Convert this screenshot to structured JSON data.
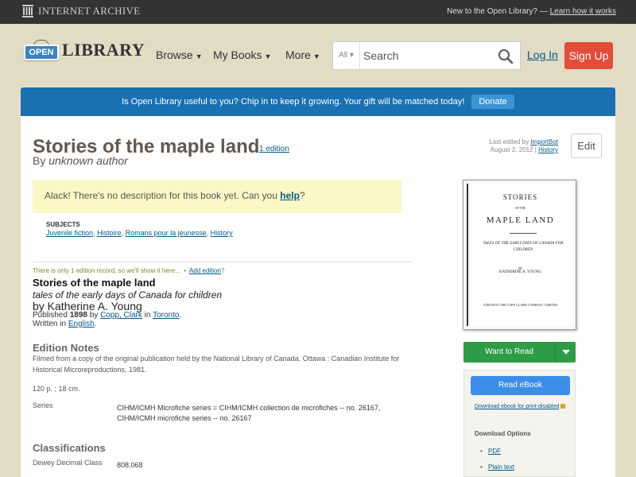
{
  "topbar": {
    "brand": "INTERNET ARCHIVE",
    "new_prompt": "New to the Open Library? —",
    "learn_link": "Learn how it works"
  },
  "header": {
    "logo_open": "OPEN",
    "logo_library": "LIBRARY",
    "nav": {
      "browse": "Browse",
      "my_books": "My Books",
      "more": "More"
    },
    "search": {
      "scope": "All",
      "placeholder": "Search"
    },
    "login": "Log In",
    "signup": "Sign Up"
  },
  "banner": {
    "text": "Is Open Library useful to you? Chip in to keep it growing. Your gift will be matched today!",
    "donate": "Donate"
  },
  "work": {
    "title": "Stories of the maple land",
    "editions_link": "1 edition",
    "by_prefix": "By",
    "author": "unknown author",
    "last_edited_prefix": "Last edited by",
    "last_edited_user": "ImportBot",
    "last_edited_date": "August 2, 2012 |",
    "history_link": "History",
    "edit_button": "Edit",
    "no_description": "Alack! There's no description for this book yet. Can you",
    "help_link": "help",
    "no_description_end": "?",
    "subjects_label": "SUBJECTS",
    "subjects": [
      "Juvenile fiction",
      "Histoire",
      "Romans pour la jeunesse",
      "History"
    ]
  },
  "edition": {
    "only_one_text": "There is only 1 edition record, so we'll show it here...",
    "separator": "•",
    "add_edition": "Add edition",
    "add_edition_suffix": "?",
    "title": "Stories of the maple land",
    "subtitle": "tales of the early days of Canada for children",
    "by_line": "by Katherine A. Young",
    "published_prefix": "Published",
    "year": "1898",
    "by_word": "by",
    "publisher": "Copp, Clark",
    "in_word": "in",
    "place": "Toronto",
    "period": ".",
    "written_prefix": "Written in",
    "language": "English"
  },
  "notes": {
    "heading": "Edition Notes",
    "text": "Filmed from a copy of the original publication held by the National Library of Canada. Ottawa : Canadian Institute for Historical Microreproductions, 1981.",
    "pages": "120 p. ; 18 cm.",
    "series_label": "Series",
    "series_1": "CIHM/ICMH Microfiche series = CIHM/ICMH collection de microfiches -- no. 26167,",
    "series_2": "CIHM/ICMH microfiche series -- no. 26167"
  },
  "classifications": {
    "heading": "Classifications",
    "dewey_label": "Dewey Decimal Class",
    "dewey_value": "808.068"
  },
  "cover": {
    "line1": "STORIES",
    "line2": "OF THE",
    "line3": "MAPLE LAND",
    "subtitle": "TALES OF THE EARLY DAYS OF CANADA FOR CHILDREN",
    "by": "BY",
    "author": "KATHERINE A. YOUNG",
    "publisher": "TORONTO: THE COPP, CLARK COMPANY, LIMITED"
  },
  "sidebar": {
    "want_to_read": "Want to Read",
    "read_ebook": "Read eBook",
    "print_disabled": "Download ebook for print-disabled",
    "download_options": "Download Options",
    "pdf": "PDF",
    "plain_text": "Plain text"
  },
  "colors": {
    "banner": "#1a71b2",
    "signup": "#e44c3a",
    "want_to_read": "#2e9b47",
    "read_ebook": "#3d8ee8",
    "link": "#02598b"
  }
}
